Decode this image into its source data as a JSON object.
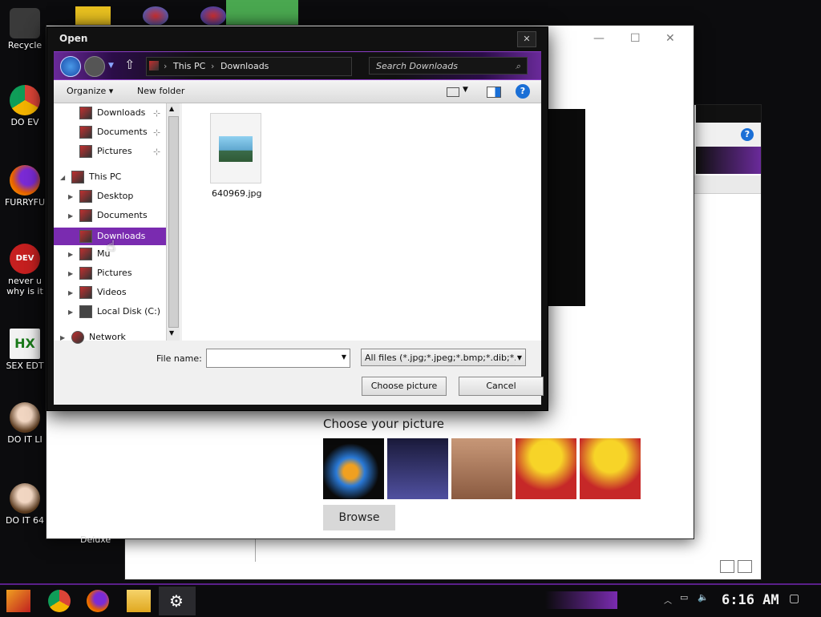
{
  "desktop": {
    "icons": [
      {
        "label": "Recycle",
        "icon": "recycle-bin-icon",
        "color": "#4d4d4d"
      },
      {
        "label": "DO EV",
        "icon": "chrome-icon",
        "color": "#2a8f3a"
      },
      {
        "label": "FURRYFU",
        "icon": "firefox-icon",
        "color": "#e66000"
      },
      {
        "label": "never u",
        "label2": "why is it",
        "icon": "devcpp-icon",
        "color": "#c02020"
      },
      {
        "label": "SEX EDT",
        "icon": "hex-editor-icon",
        "color": "#e8e8e8"
      },
      {
        "label": "DO IT LI",
        "icon": "portrait-icon",
        "color": "#9b6a3a"
      },
      {
        "label": "DO IT 64",
        "icon": "portrait-icon",
        "color": "#9b6a3a"
      }
    ],
    "deluxe_label": "Deluxe"
  },
  "bg_window": {
    "choose_picture_label": "Choose your picture",
    "browse_label": "Browse"
  },
  "dialog": {
    "title": "Open",
    "breadcrumb": [
      "This PC",
      "Downloads"
    ],
    "search_placeholder": "Search Downloads",
    "toolbar": {
      "organize_label": "Organize",
      "new_folder_label": "New folder"
    },
    "nav": {
      "quick_access": [
        "Downloads",
        "Documents",
        "Pictures"
      ],
      "this_pc_label": "This PC",
      "this_pc_children": [
        "Desktop",
        "Documents",
        "Downloads",
        "Mu",
        "Pictures",
        "Videos",
        "Local Disk (C:)"
      ],
      "network_label": "Network",
      "selected": "Downloads"
    },
    "files": [
      {
        "name": "640969.jpg",
        "icon": "image-file-icon"
      }
    ],
    "file_name_label": "File name:",
    "file_name_value": "",
    "file_type_value": "All files (*.jpg;*.jpeg;*.bmp;*.dib;*.p",
    "choose_button": "Choose picture",
    "cancel_button": "Cancel",
    "accent_color": "#7a2bb0"
  },
  "taskbar": {
    "clock": "6:16 AM",
    "accent_color": "#5a1f8a"
  }
}
